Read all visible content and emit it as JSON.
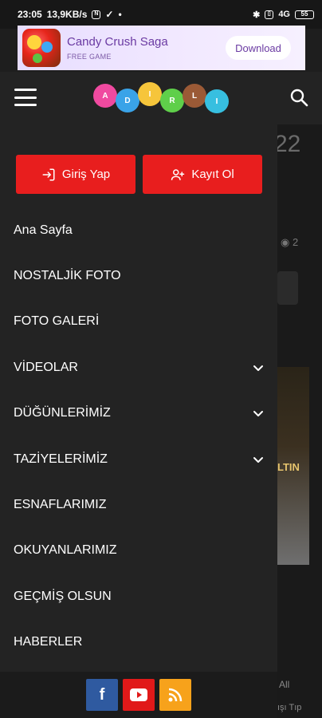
{
  "status_bar": {
    "time": "23:05",
    "speed": "13,9KB/s",
    "signal_label": "4G",
    "battery": "55"
  },
  "ad": {
    "title": "Candy Crush Saga",
    "subtitle": "FREE GAME",
    "cta": "Download",
    "icon": "candy-crush-app-icon"
  },
  "header": {
    "menu_icon": "hamburger-icon",
    "logo_letters": [
      "A",
      "D",
      "I",
      "R",
      "L",
      "I"
    ],
    "logo_colors": [
      "#f04aa0",
      "#3aa3e8",
      "#f6c53b",
      "#5fcf4a",
      "#9b5a36",
      "#37bfe0"
    ],
    "search_icon": "search-icon"
  },
  "auth": {
    "login_label": "Giriş Yap",
    "register_label": "Kayıt Ol"
  },
  "menu": {
    "items": [
      {
        "label": "Ana Sayfa",
        "has_submenu": false
      },
      {
        "label": "NOSTALJİK FOTO",
        "has_submenu": false
      },
      {
        "label": "FOTO GALERİ",
        "has_submenu": false
      },
      {
        "label": "VİDEOLAR",
        "has_submenu": true
      },
      {
        "label": "DÜĞÜNLERİMİZ",
        "has_submenu": true
      },
      {
        "label": "TAZİYELERİMİZ",
        "has_submenu": true
      },
      {
        "label": "ESNAFLARIMIZ",
        "has_submenu": false
      },
      {
        "label": "OKUYANLARIMIZ",
        "has_submenu": false
      },
      {
        "label": "GEÇMİŞ OLSUN",
        "has_submenu": false
      },
      {
        "label": "HABERLER",
        "has_submenu": false
      }
    ]
  },
  "social": {
    "facebook": "f",
    "youtube_icon": "youtube-icon",
    "rss_icon": "rss-icon"
  },
  "background": {
    "number": "22",
    "views": "2",
    "image_text": "LTIN",
    "tail1": "All",
    "tail2": "ışı Tıp"
  },
  "colors": {
    "accent_red": "#e81e1e",
    "drawer_bg": "#232323"
  }
}
